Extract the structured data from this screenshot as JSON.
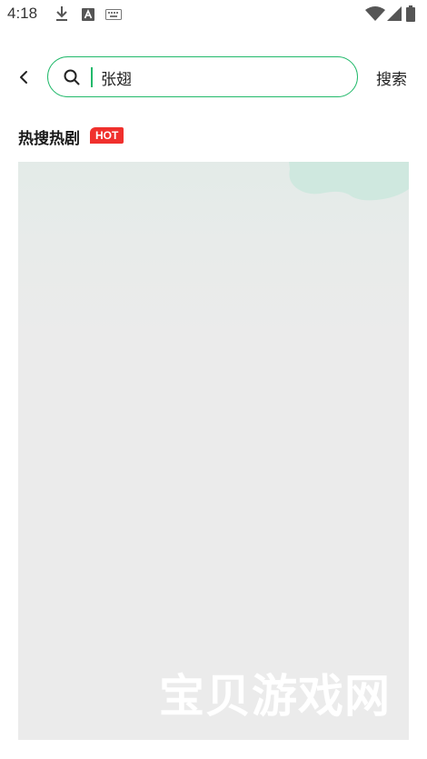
{
  "status_bar": {
    "time": "4:18",
    "icons": [
      "download-icon",
      "text-a-icon",
      "keyboard-icon",
      "wifi-icon",
      "signal-icon",
      "battery-icon"
    ]
  },
  "search": {
    "value": "张翅",
    "button_label": "搜索"
  },
  "hot_section": {
    "title": "热搜热剧",
    "badge": "HOT"
  },
  "banner": {
    "watermark": "宝贝游戏网"
  },
  "colors": {
    "accent": "#22b96b",
    "hot_badge": "#f0302d",
    "banner_bg": "#ebebeb"
  }
}
